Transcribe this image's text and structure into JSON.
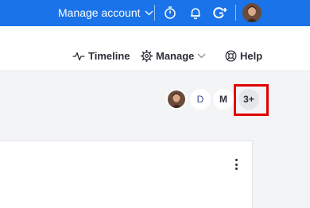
{
  "topbar": {
    "manage_account_label": "Manage account",
    "icons": [
      "chevron-down-icon",
      "stopwatch-icon",
      "bell-icon",
      "add-icon",
      "user-avatar"
    ],
    "background_color": "#1a73e8"
  },
  "navbar": {
    "timeline_label": "Timeline",
    "manage_label": "Manage",
    "help_label": "Help"
  },
  "collaborators": {
    "items": [
      {
        "type": "photo",
        "label": ""
      },
      {
        "type": "initial",
        "label": "D"
      },
      {
        "type": "initial",
        "label": "M"
      },
      {
        "type": "more",
        "label": "3+"
      }
    ],
    "highlight_color": "#e00000"
  }
}
